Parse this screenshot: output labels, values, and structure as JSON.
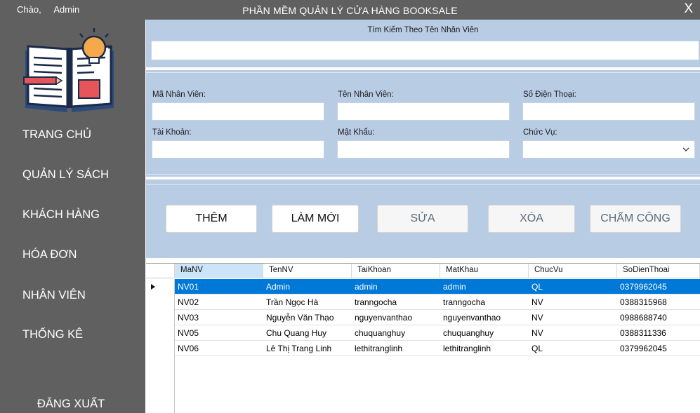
{
  "window": {
    "greeting": "Chào,",
    "user": "Admin",
    "title": "PHẦN MỀM QUẢN LÝ CỬA HÀNG BOOKSALE",
    "close_label": "X"
  },
  "sidebar": {
    "items": [
      {
        "label": "TRANG CHỦ"
      },
      {
        "label": "QUẢN LÝ SÁCH"
      },
      {
        "label": "KHÁCH HÀNG"
      },
      {
        "label": "HÓA ĐƠN"
      },
      {
        "label": "NHÂN VIÊN"
      },
      {
        "label": "THỐNG KÊ"
      }
    ],
    "logout_label": "ĐĂNG XUẤT",
    "logo_icon": "open-book-lightbulb-icon"
  },
  "search": {
    "label": "Tìm Kiếm Theo Tên Nhân Viên",
    "value": ""
  },
  "form": {
    "ma_nv_label": "Mã Nhân Viên:",
    "ten_nv_label": "Tên Nhân Viên:",
    "sdt_label": "Số Điện Thoại:",
    "tai_khoan_label": "Tài Khoản:",
    "mat_khau_label": "Mật Khẩu:",
    "chuc_vu_label": "Chức Vụ:",
    "ma_nv_value": "",
    "ten_nv_value": "",
    "sdt_value": "",
    "tai_khoan_value": "",
    "mat_khau_value": "",
    "chuc_vu_value": ""
  },
  "buttons": {
    "add": "THÊM",
    "refresh": "LÀM MỚI",
    "edit": "SỬA",
    "delete": "XÓA",
    "timekeeping": "CHẤM CÔNG"
  },
  "table": {
    "columns": [
      "MaNV",
      "TenNV",
      "TaiKhoan",
      "MatKhau",
      "ChucVu",
      "SoDienThoai"
    ],
    "rows": [
      [
        "NV01",
        "Admin",
        "admin",
        "admin",
        "QL",
        "0379962045"
      ],
      [
        "NV02",
        "Trần Ngọc Hà",
        "tranngocha",
        "tranngocha",
        "NV",
        "0388315968"
      ],
      [
        "NV03",
        "Nguyễn Văn Thạo",
        "nguyenvanthao",
        "nguyenvanthao",
        "NV",
        "0988688740"
      ],
      [
        "NV05",
        "Chu Quang Huy",
        "chuquanghuy",
        "chuquanghuy",
        "NV",
        "0388311336"
      ],
      [
        "NV06",
        "Lê Thị Trang Linh",
        "lethitranglinh",
        "lethitranglinh",
        "QL",
        "0379962045"
      ]
    ]
  },
  "colors": {
    "sidebar_bg": "#606060",
    "panel_bg": "#b8cce4",
    "selected_row": "#0078d7"
  }
}
